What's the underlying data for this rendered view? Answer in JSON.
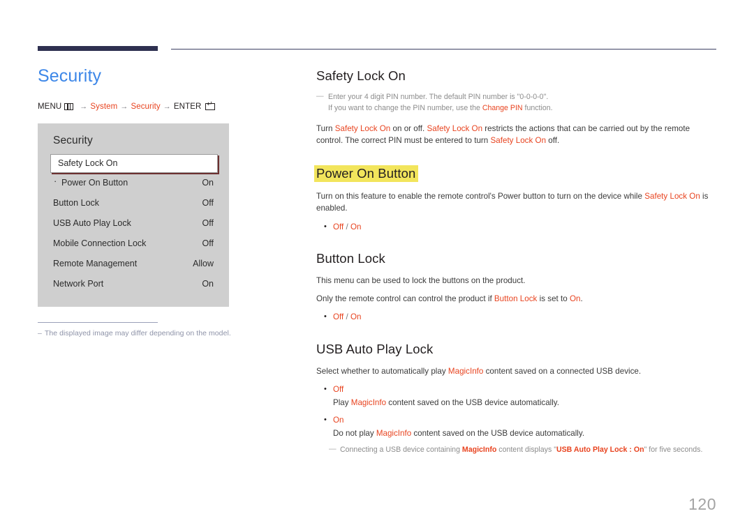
{
  "document": {
    "page_number": "120",
    "page_title": "Security"
  },
  "breadcrumb": {
    "menu_label": "MENU",
    "menu_icon": "menu-grid-icon",
    "arrow": "→",
    "step1": "System",
    "step2": "Security",
    "enter_label": "ENTER",
    "enter_icon": "enter-key-icon"
  },
  "osd": {
    "title": "Security",
    "selected_item": "Safety Lock On",
    "rows": [
      {
        "label": "Power On Button",
        "value": "On",
        "sub": true
      },
      {
        "label": "Button Lock",
        "value": "Off",
        "sub": false
      },
      {
        "label": "USB Auto Play Lock",
        "value": "Off",
        "sub": false
      },
      {
        "label": "Mobile Connection Lock",
        "value": "Off",
        "sub": false
      },
      {
        "label": "Remote Management",
        "value": "Allow",
        "sub": false
      },
      {
        "label": "Network Port",
        "value": "On",
        "sub": false
      }
    ]
  },
  "footnote": {
    "dash": "–",
    "text": "The displayed image may differ depending on the model."
  },
  "sections": {
    "safety_lock_on": {
      "heading": "Safety Lock On",
      "note_dash": "—",
      "note_line1": "Enter your 4 digit PIN number. The default PIN number is \"0-0-0-0\".",
      "note_line2_a": "If you want to change the PIN number, use the ",
      "note_line2_accent": "Change PIN",
      "note_line2_b": " function.",
      "para_a": "Turn ",
      "para_accent1": "Safety Lock On",
      "para_b": " on or off. ",
      "para_accent2": "Safety Lock On",
      "para_c": " restricts the actions that can be carried out by the remote control. The correct PIN must be entered to turn ",
      "para_accent3": "Safety Lock On",
      "para_d": " off."
    },
    "power_on_button": {
      "heading": "Power On Button",
      "highlight_color": "#f2e55c",
      "para_a": "Turn on this feature to enable the remote control's Power button to turn on the device while ",
      "para_accent": "Safety Lock On",
      "para_b": " is enabled.",
      "option_off": "Off",
      "option_slash": " / ",
      "option_on": "On"
    },
    "button_lock": {
      "heading": "Button Lock",
      "para1": "This menu can be used to lock the buttons on the product.",
      "para2_a": "Only the remote control can control the product if ",
      "para2_accent1": "Button Lock",
      "para2_b": " is set to ",
      "para2_accent2": "On",
      "para2_c": ".",
      "option_off": "Off",
      "option_slash": " / ",
      "option_on": "On"
    },
    "usb_auto_play_lock": {
      "heading": "USB Auto Play Lock",
      "intro_a": "Select whether to automatically play ",
      "intro_accent": "MagicInfo",
      "intro_b": " content saved on a connected USB device.",
      "opt1_label": "Off",
      "opt1_desc_a": "Play ",
      "opt1_desc_accent": "MagicInfo",
      "opt1_desc_b": " content saved on the USB device automatically.",
      "opt2_label": "On",
      "opt2_desc_a": "Do not play ",
      "opt2_desc_accent": "MagicInfo",
      "opt2_desc_b": " content saved on the USB device automatically.",
      "note_dash": "—",
      "note_a": "Connecting a USB device containing ",
      "note_accent1": "MagicInfo",
      "note_b": " content displays \"",
      "note_accent2": "USB Auto Play Lock : On",
      "note_c": "\" for five seconds."
    }
  },
  "colors": {
    "title_blue": "#3d87e8",
    "accent_red": "#e8431f",
    "rule_navy": "#2e3050",
    "osd_bg": "#cfcfcf",
    "highlight_yellow": "#f2e55c"
  }
}
